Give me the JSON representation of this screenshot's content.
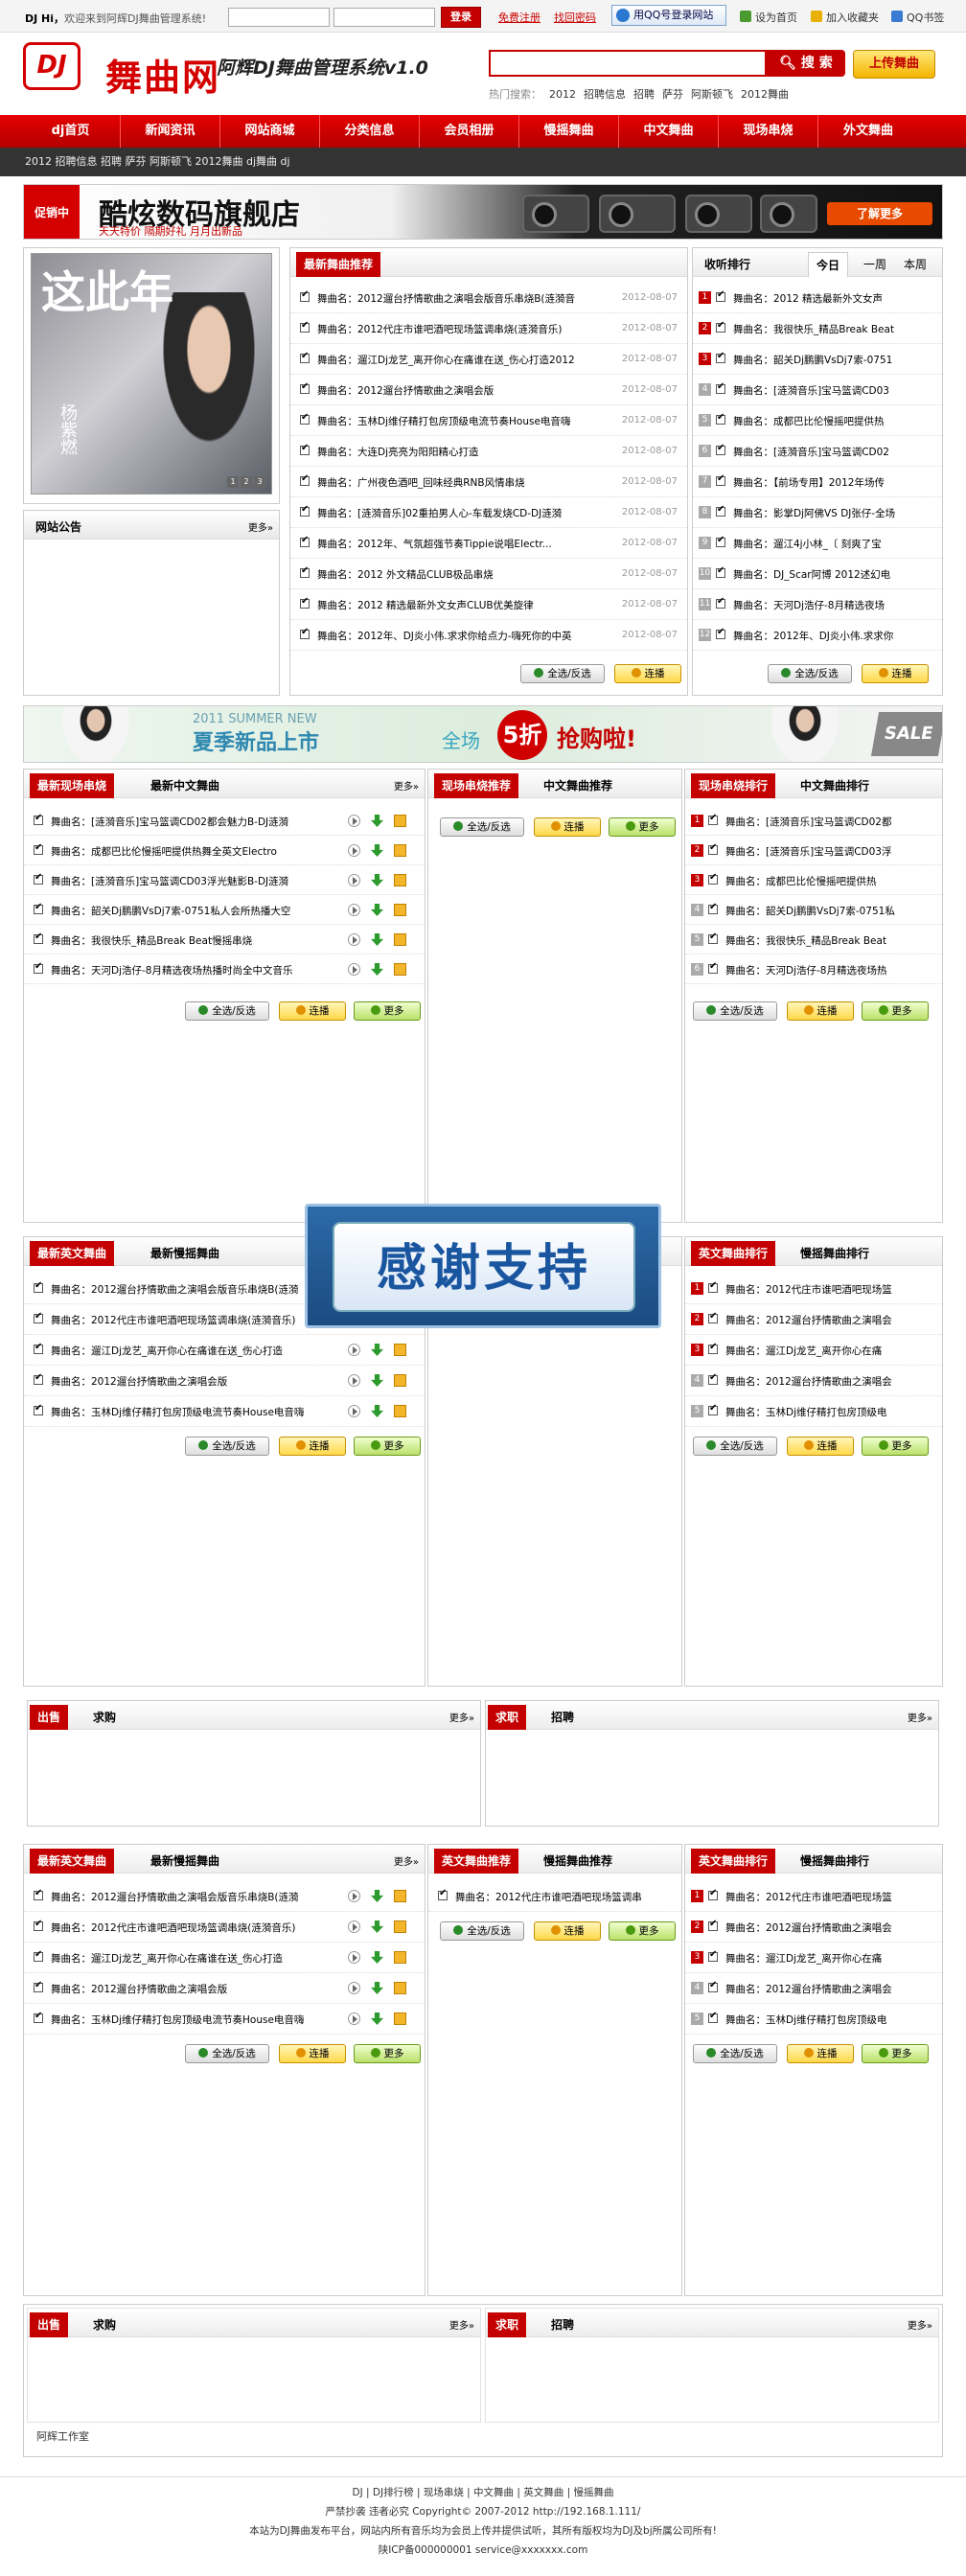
{
  "topbar": {
    "hi": "DJ Hi，",
    "welcome": "欢迎来到阿辉DJ舞曲管理系统!",
    "login": "登录",
    "register": "免费注册",
    "forgot": "找回密码",
    "qq": "用QQ号登录网站",
    "home": "设为首页",
    "fav": "加入收藏夹",
    "qqbook": "QQ书签"
  },
  "header": {
    "logo": "DJ",
    "site": "舞曲网",
    "slogan": "阿辉DJ舞曲管理系统v1.0",
    "search_btn": "搜 索",
    "upload_btn": "上传舞曲",
    "hot_label": "热门搜索：",
    "hot": [
      "2012",
      "招聘信息",
      "招聘",
      "萨芬",
      "阿斯顿飞",
      "2012舞曲"
    ]
  },
  "nav": [
    "dj首页",
    "新闻资讯",
    "网站商城",
    "分类信息",
    "会员相册",
    "慢摇舞曲",
    "中文舞曲",
    "现场串烧",
    "外文舞曲"
  ],
  "subnav": "2012 招聘信息 招聘 萨芬 阿斯顿飞 2012舞曲 dj舞曲 dj",
  "banner1": {
    "badge": "促销中",
    "title": "酷炫数码旗舰店",
    "sub": "天天特价 隔期好礼 月月出新品",
    "more": "了解更多"
  },
  "feature": {
    "big": "这此年",
    "name": "杨紫燃",
    "pages": [
      "1",
      "2",
      "3"
    ]
  },
  "notice": {
    "title": "网站公告",
    "more": "更多»"
  },
  "latest": {
    "title": "最新舞曲推荐",
    "rows": [
      [
        "舞曲名：2012遛台抒情歌曲之演唱会版音乐串烧B(涟漪音",
        "2012-08-07"
      ],
      [
        "舞曲名：2012代庄市谁吧酒吧现场篮调串烧(涟漪音乐)",
        "2012-08-07"
      ],
      [
        "舞曲名：遛江Dj龙艺_离开你心在痛谁在送_伤心打造2012",
        "2012-08-07"
      ],
      [
        "舞曲名：2012遛台抒情歌曲之演唱会版",
        "2012-08-07"
      ],
      [
        "舞曲名：玉林Dj维仔精打包房顶级电流节奏House电音嗨",
        "2012-08-07"
      ],
      [
        "舞曲名：大连Dj亮亮为阳阳精心打造",
        "2012-08-07"
      ],
      [
        "舞曲名：广州夜色酒吧_回味经典RNB风情串烧",
        "2012-08-07"
      ],
      [
        "舞曲名：[涟漪音乐]02重拍男人心-车载发烧CD-DJ涟漪",
        "2012-08-07"
      ],
      [
        "舞曲名：2012年、气氛超强节奏Tippie说唱Electr...",
        "2012-08-07"
      ],
      [
        "舞曲名：2012 外文精品CLUB极品串烧",
        "2012-08-07"
      ],
      [
        "舞曲名：2012 精选最新外文女声CLUB优美旋律",
        "2012-08-07"
      ],
      [
        "舞曲名：2012年、DJ炎小伟.求求你给点力-嗨死你的中英",
        "2012-08-07"
      ]
    ],
    "select_all": "全选/反选",
    "play": "连播"
  },
  "rank": {
    "title": "收听排行",
    "tabs": [
      "今日",
      "一周",
      "本周"
    ],
    "rows": [
      "舞曲名：2012 精选最新外文女声",
      "舞曲名：我很快乐_精品Break Beat",
      "舞曲名：韶关Dj鹏鹏VsDj7索-0751",
      "舞曲名：[涟漪音乐]宝马篮调CD03",
      "舞曲名：成都巴比伦慢摇吧提供热",
      "舞曲名：[涟漪音乐]宝马篮调CD02",
      "舞曲名：【前场专用】2012年场传",
      "舞曲名：影掌Dj阿佛VS DJ张仔-全场",
      "舞曲名：遛江4j小林_〔 刻爽了宝",
      "舞曲名：DJ_Scar阿博 2012述幻电",
      "舞曲名：天河Dj浩仔-8月精选夜场",
      "舞曲名：2012年、DJ炎小伟.求求你"
    ],
    "select_all": "全选/反选",
    "play": "连播"
  },
  "banner2": {
    "s1": "2011 SUMMER NEW",
    "s2": "夏季新品上市",
    "s3": "全场",
    "circ": "5折",
    "s4": "抢购啦!",
    "sale": "SALE"
  },
  "sec1": {
    "a": {
      "tab": "最新现场串烧",
      "tab2": "最新中文舞曲",
      "more": "更多»",
      "rows": [
        "舞曲名：[涟漪音乐]宝马篮调CD02都会魅力B-DJ涟漪",
        "舞曲名：成都巴比伦慢摇吧提供热舞全英文Electro",
        "舞曲名：[涟漪音乐]宝马篮调CD03浮光魅影B-DJ涟漪",
        "舞曲名：韶关Dj鹏鹏VsDj7索-0751私人会所热播大空",
        "舞曲名：我很快乐_精品Break Beat慢摇串烧",
        "舞曲名：天河Dj浩仔-8月精选夜场热播时尚全中文音乐"
      ]
    },
    "b": {
      "tab": "现场串烧推荐",
      "tab2": "中文舞曲推荐",
      "rows": []
    },
    "c": {
      "tab": "现场串烧排行",
      "tab2": "中文舞曲排行",
      "rows": [
        "舞曲名：[涟漪音乐]宝马篮调CD02都",
        "舞曲名：[涟漪音乐]宝马篮调CD03浮",
        "舞曲名：成都巴比伦慢摇吧提供热",
        "舞曲名：韶关Dj鹏鹏VsDj7索-0751私",
        "舞曲名：我很快乐_精品Break Beat",
        "舞曲名：天河Dj浩仔-8月精选夜场热"
      ]
    },
    "select_all": "全选/反选",
    "play": "连播",
    "more_btn": "更多"
  },
  "sec2": {
    "a": {
      "tab": "最新英文舞曲",
      "tab2": "最新慢摇舞曲",
      "rows": [
        "舞曲名：2012遛台抒情歌曲之演唱会版音乐串烧B(涟漪",
        "舞曲名：2012代庄市谁吧酒吧现场篮调串烧(涟漪音乐)",
        "舞曲名：遛江Dj龙艺_离开你心在痛谁在送_伤心打造",
        "舞曲名：2012遛台抒情歌曲之演唱会版",
        "舞曲名：玉林Dj维仔精打包房顶级电流节奏House电音嗨"
      ]
    },
    "c": {
      "tab": "英文舞曲排行",
      "tab2": "慢摇舞曲排行",
      "rows": [
        "舞曲名：2012代庄市谁吧酒吧现场篮",
        "舞曲名：2012遛台抒情歌曲之演唱会",
        "舞曲名：遛江Dj龙艺_离开你心在痛",
        "舞曲名：2012遛台抒情歌曲之演唱会",
        "舞曲名：玉林Dj维仔精打包房顶级电"
      ]
    },
    "thanks": "感谢支持"
  },
  "jobs1": {
    "a": "出售",
    "a2": "求购",
    "b": "求职",
    "b2": "招聘",
    "more": "更多»"
  },
  "sec3": {
    "a": {
      "tab": "最新英文舞曲",
      "tab2": "最新慢摇舞曲",
      "more": "更多»",
      "rows": [
        "舞曲名：2012遛台抒情歌曲之演唱会版音乐串烧B(涟漪",
        "舞曲名：2012代庄市谁吧酒吧现场篮调串烧(涟漪音乐)",
        "舞曲名：遛江Dj龙艺_离开你心在痛谁在送_伤心打造",
        "舞曲名：2012遛台抒情歌曲之演唱会版",
        "舞曲名：玉林Dj维仔精打包房顶级电流节奏House电音嗨"
      ]
    },
    "b": {
      "tab": "英文舞曲推荐",
      "tab2": "慢摇舞曲推荐",
      "rows": [
        "舞曲名：2012代庄市谁吧酒吧现场篮调串"
      ]
    },
    "c": {
      "tab": "英文舞曲排行",
      "tab2": "慢摇舞曲排行",
      "rows": [
        "舞曲名：2012代庄市谁吧酒吧现场篮",
        "舞曲名：2012遛台抒情歌曲之演唱会",
        "舞曲名：遛江Dj龙艺_离开你心在痛",
        "舞曲名：2012遛台抒情歌曲之演唱会",
        "舞曲名：玉林Dj维仔精打包房顶级电"
      ]
    }
  },
  "jobs2": {
    "a": "出售",
    "a2": "求购",
    "b": "求职",
    "b2": "招聘",
    "more": "更多»",
    "studio": "阿辉工作室"
  },
  "footer": {
    "links": "DJ | DJ排行榜 | 现场串烧 | 中文舞曲 | 英文舞曲 | 慢摇舞曲",
    "l2": "严禁抄袭 违者必究 Copyright© 2007-2012 http://192.168.1.111/",
    "l3": "本站为DJ舞曲发布平台，网站内所有音乐均为会员上传并提供试听，其所有版权均为DJ及bj所属公司所有!",
    "l4": "陕ICP备000000001 service@xxxxxxx.com"
  }
}
